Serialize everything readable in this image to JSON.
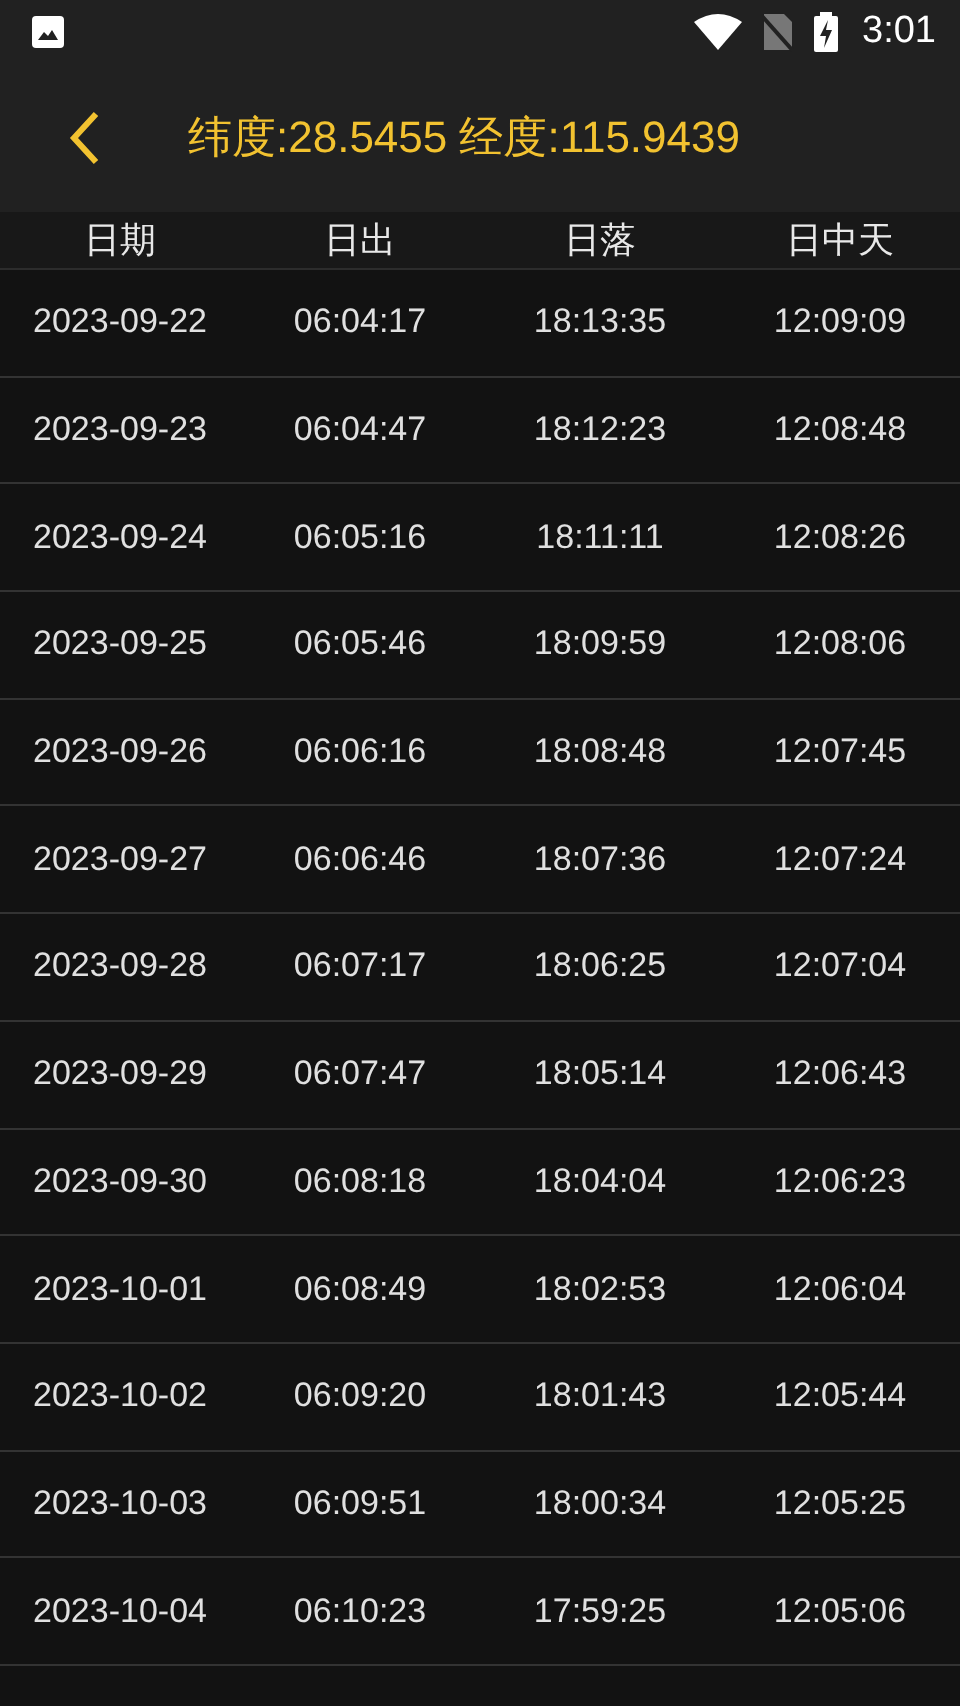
{
  "status_bar": {
    "time": "3:01"
  },
  "header": {
    "title": "纬度:28.5455 经度:115.9439"
  },
  "table": {
    "columns": [
      "日期",
      "日出",
      "日落",
      "日中天"
    ],
    "rows": [
      [
        "2023-09-22",
        "06:04:17",
        "18:13:35",
        "12:09:09"
      ],
      [
        "2023-09-23",
        "06:04:47",
        "18:12:23",
        "12:08:48"
      ],
      [
        "2023-09-24",
        "06:05:16",
        "18:11:11",
        "12:08:26"
      ],
      [
        "2023-09-25",
        "06:05:46",
        "18:09:59",
        "12:08:06"
      ],
      [
        "2023-09-26",
        "06:06:16",
        "18:08:48",
        "12:07:45"
      ],
      [
        "2023-09-27",
        "06:06:46",
        "18:07:36",
        "12:07:24"
      ],
      [
        "2023-09-28",
        "06:07:17",
        "18:06:25",
        "12:07:04"
      ],
      [
        "2023-09-29",
        "06:07:47",
        "18:05:14",
        "12:06:43"
      ],
      [
        "2023-09-30",
        "06:08:18",
        "18:04:04",
        "12:06:23"
      ],
      [
        "2023-10-01",
        "06:08:49",
        "18:02:53",
        "12:06:04"
      ],
      [
        "2023-10-02",
        "06:09:20",
        "18:01:43",
        "12:05:44"
      ],
      [
        "2023-10-03",
        "06:09:51",
        "18:00:34",
        "12:05:25"
      ],
      [
        "2023-10-04",
        "06:10:23",
        "17:59:25",
        "12:05:06"
      ]
    ]
  }
}
